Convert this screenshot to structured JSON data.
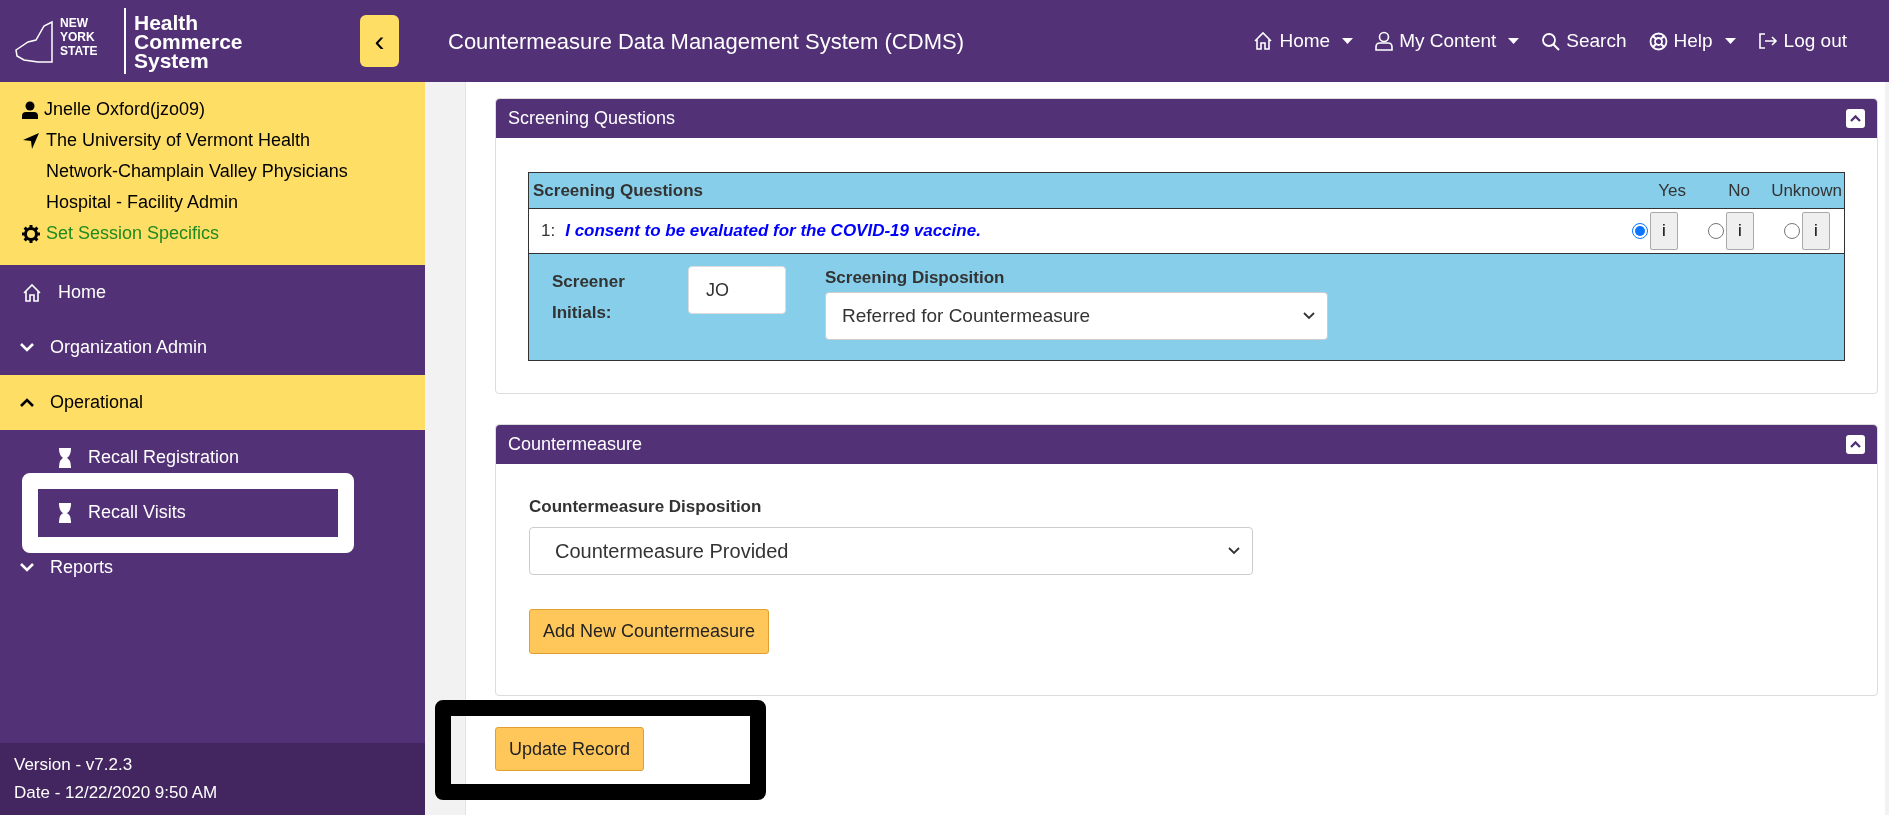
{
  "header": {
    "logo_lines": [
      "Health",
      "Commerce",
      "System"
    ],
    "state_lines": [
      "NEW",
      "YORK",
      "STATE"
    ],
    "collapse_button": "‹",
    "title": "Countermeasure Data Management System (CDMS)",
    "nav": [
      {
        "kind": "home",
        "label": "Home",
        "dropdown": true
      },
      {
        "kind": "user",
        "label": "My Content",
        "dropdown": true
      },
      {
        "kind": "search",
        "label": "Search",
        "dropdown": false
      },
      {
        "kind": "help",
        "label": "Help",
        "dropdown": true
      },
      {
        "kind": "logout",
        "label": "Log out",
        "dropdown": false
      }
    ]
  },
  "session": {
    "user": "Jnelle Oxford(jzo09)",
    "facility": "The University of Vermont Health Network-Champlain Valley Physicians Hospital - Facility Admin",
    "link": "Set Session Specifics"
  },
  "sidebar": {
    "items": [
      {
        "kind": "home",
        "label": "Home",
        "selected": false
      },
      {
        "kind": "group",
        "label": "Organization Admin",
        "expanded": false,
        "selected": false
      },
      {
        "kind": "group",
        "label": "Operational",
        "expanded": true,
        "selected": true,
        "children": [
          {
            "kind": "leaf",
            "label": "Recall Registration",
            "selected": false
          },
          {
            "kind": "leaf",
            "label": "Recall Visits",
            "selected": true,
            "highlighted": true
          }
        ]
      },
      {
        "kind": "group",
        "label": "Reports",
        "expanded": false,
        "selected": false
      }
    ]
  },
  "version": "Version - v7.2.3",
  "date": "Date - 12/22/2020 9:50 AM",
  "screening": {
    "title": "Screening Questions",
    "table_title": "Screening Questions",
    "options": [
      "Yes",
      "No",
      "Unknown"
    ],
    "questions": [
      {
        "number": "1:",
        "text": "I consent to be evaluated for the COVID-19 vaccine.",
        "answers": [
          {
            "selected": true,
            "info": "i"
          },
          {
            "selected": false,
            "info": "i"
          },
          {
            "selected": false,
            "info": "i"
          }
        ]
      }
    ],
    "initials_label": "Screener Initials:",
    "initials": "JO",
    "disposition_label": "Screening Disposition",
    "disposition": "Referred for Countermeasure"
  },
  "countermeasure": {
    "title": "Countermeasure",
    "disposition_label": "Countermeasure Disposition",
    "disposition": "Countermeasure Provided",
    "add_button": "Add New Countermeasure"
  },
  "update_button": {
    "label": "Update Record",
    "highlighted": true
  }
}
